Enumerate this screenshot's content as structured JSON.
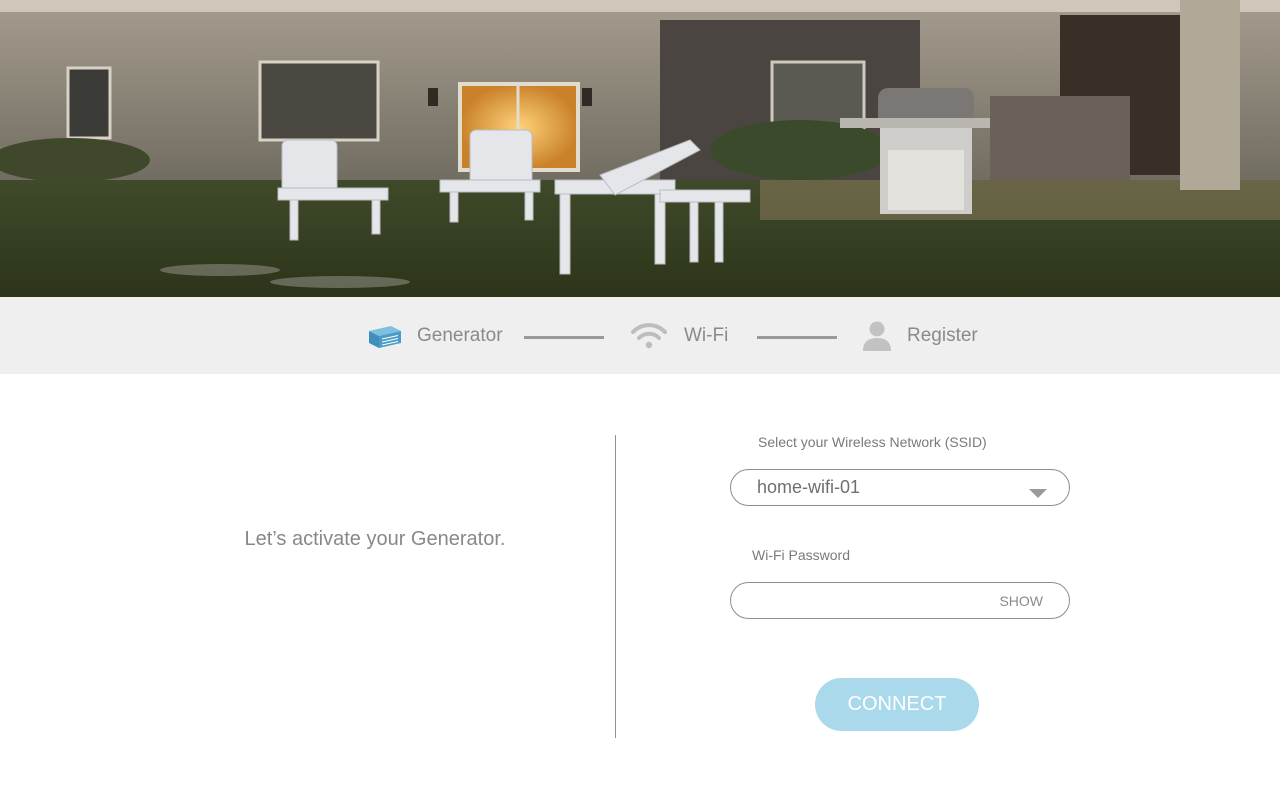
{
  "hero": {
    "image_name": "backyard-patio-photo"
  },
  "stepper": {
    "steps": [
      {
        "label": "Generator",
        "icon": "generator-icon",
        "color": "#4a9cc7"
      },
      {
        "label": "Wi-Fi",
        "icon": "wifi-icon",
        "color": "#b8b8b8"
      },
      {
        "label": "Register",
        "icon": "user-icon",
        "color": "#b8b8b8"
      }
    ]
  },
  "intro": {
    "text": "Let’s activate your Generator."
  },
  "form": {
    "ssid_label": "Select your Wireless Network (SSID)",
    "ssid_value": "home-wifi-01",
    "password_label": "Wi-Fi Password",
    "password_value": "",
    "show_label": "SHOW",
    "connect_label": "CONNECT"
  },
  "colors": {
    "accent": "#a9d9ea",
    "stepper_bg": "#efefef",
    "text_muted": "#8a8a8a"
  }
}
